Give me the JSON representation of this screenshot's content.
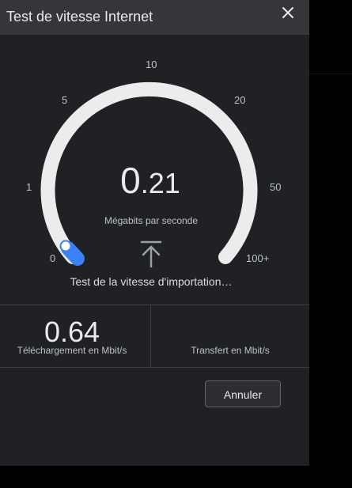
{
  "dialog": {
    "title": "Test de vitesse Internet",
    "close_icon": "close-icon"
  },
  "gauge": {
    "ticks": [
      "0",
      "1",
      "5",
      "10",
      "20",
      "50",
      "100+"
    ],
    "progress_value": 0.21,
    "speed_integer": "0",
    "speed_decimal": ".21",
    "unit": "Mégabits par seconde",
    "phase_icon": "upload-icon",
    "status": "Test de la vitesse d'importation…",
    "colors": {
      "track": "#ececec",
      "progress": "#3b82f6"
    }
  },
  "results": {
    "download_value": "0.64",
    "download_label": "Téléchargement en Mbit/s",
    "upload_value": "",
    "upload_label": "Transfert en Mbit/s"
  },
  "actions": {
    "cancel_label": "Annuler"
  }
}
